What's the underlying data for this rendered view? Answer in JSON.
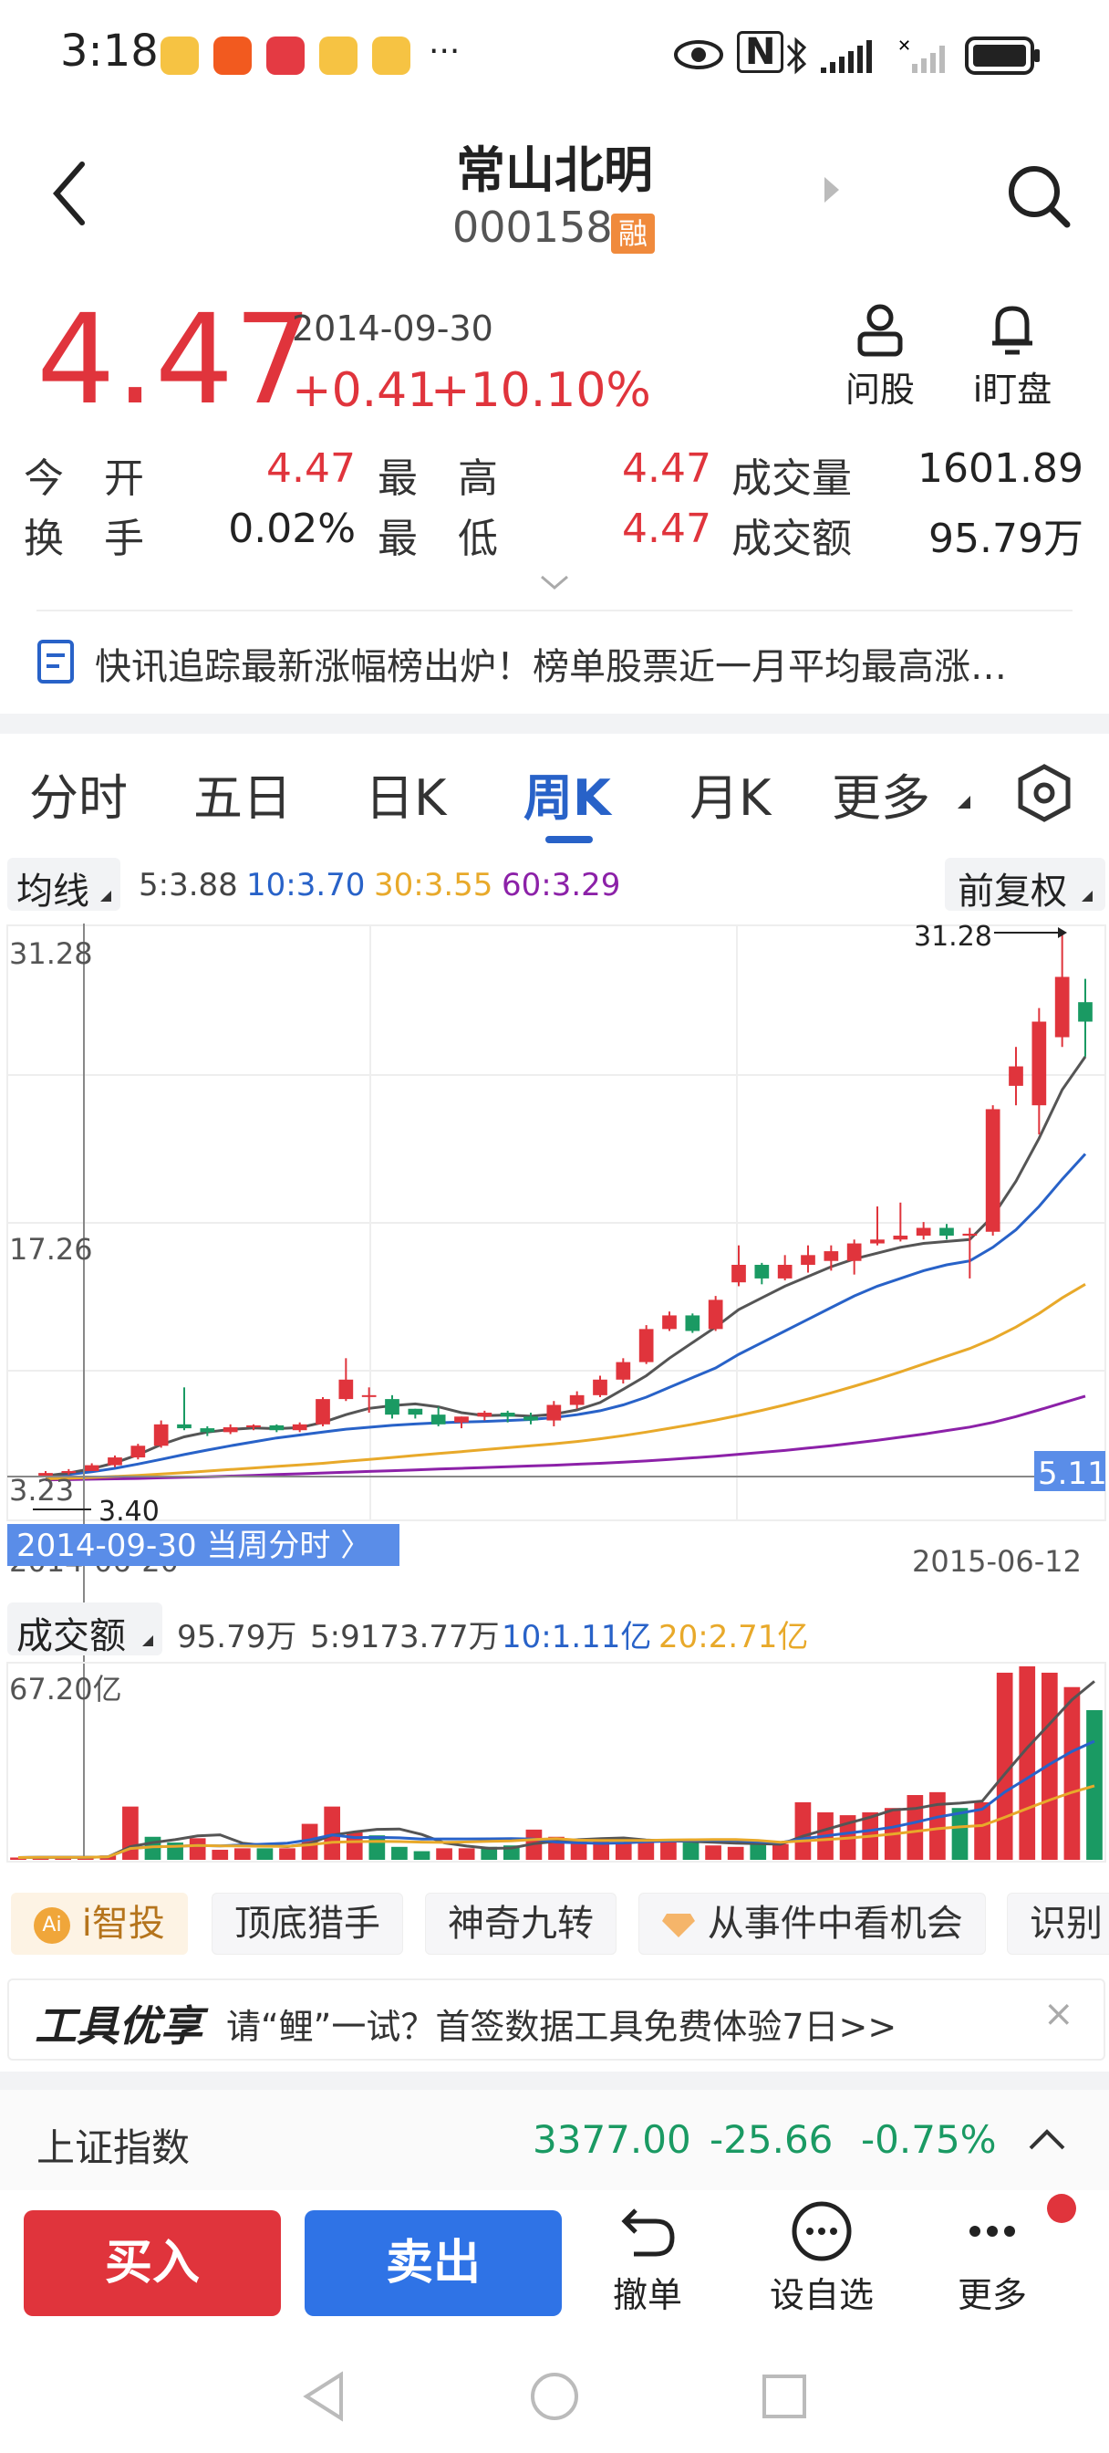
{
  "status": {
    "time": "3:18",
    "more": "···",
    "nfc": "N"
  },
  "stock": {
    "name": "常山北明",
    "code": "000158",
    "margin_badge": "融",
    "price": "4.47",
    "date": "2014-09-30",
    "change": "+0.41",
    "change_pct": "+10.10%",
    "ask_label": "问股",
    "watch_label": "i盯盘"
  },
  "quote": {
    "open_label": "今　开",
    "open_value": "4.47",
    "high_label": "最　高",
    "high_value": "4.47",
    "volume_label": "成交量",
    "volume_value": "1601.89",
    "turnover_label": "换　手",
    "turnover_value": "0.02%",
    "low_label": "最　低",
    "low_value": "4.47",
    "amount_label": "成交额",
    "amount_value": "95.79万"
  },
  "news": {
    "text": "快讯追踪最新涨幅榜出炉！榜单股票近一月平均最高涨…"
  },
  "tabs": [
    "分时",
    "五日",
    "日K",
    "周K",
    "月K",
    "更多"
  ],
  "active_tab": "周K",
  "ma_bar": {
    "selector": "均线",
    "ma5": "5:3.88",
    "ma10": "10:3.70",
    "ma30": "30:3.55",
    "ma60": "60:3.29",
    "adjust": "前复权"
  },
  "kline": {
    "axis_top": "31.28",
    "axis_mid": "17.26",
    "axis_bottom": "3.23",
    "max_label": "31.28",
    "min_label": "3.40",
    "cursor_price": "5.11",
    "cursor_link": "2014-09-30 当周分时 〉",
    "start_date": "2014-06-20",
    "end_date": "2015-06-12"
  },
  "vol_bar": {
    "selector": "成交额",
    "value": "95.79万",
    "ma5": "5:9173.77万",
    "ma10": "10:1.11亿",
    "ma20": "20:2.71亿",
    "axis_top": "67.20亿"
  },
  "chips": [
    "i智投",
    "顶底猎手",
    "神奇九转",
    "从事件中看机会",
    "识别"
  ],
  "ai_badge": "Ai",
  "promo": {
    "brand": "工具优享",
    "text": "请“鲤”一试？首签数据工具免费体验7日>>",
    "close": "×"
  },
  "index": {
    "name": "上证指数",
    "value": "3377.00",
    "change": "-25.66",
    "pct": "-0.75%"
  },
  "bottom": {
    "buy": "买入",
    "sell": "卖出",
    "cancel": "撤单",
    "watch": "设自选",
    "more": "更多"
  },
  "colors": {
    "up": "#e0343c",
    "down": "#1a9a63",
    "accent": "#2862c8",
    "ma5": "#555555",
    "ma10": "#2862c8",
    "ma30": "#e8a92a",
    "ma60": "#8c21a8"
  },
  "chart_data": {
    "type": "candlestick",
    "x_range": [
      "2014-06-20",
      "2015-06-12"
    ],
    "ylim": [
      3.23,
      31.28
    ],
    "candles": [
      {
        "o": 3.4,
        "c": 3.6,
        "h": 3.7,
        "l": 3.4
      },
      {
        "o": 3.6,
        "c": 3.7,
        "h": 3.8,
        "l": 3.5
      },
      {
        "o": 3.7,
        "c": 4.0,
        "h": 4.1,
        "l": 3.7
      },
      {
        "o": 4.0,
        "c": 4.4,
        "h": 4.5,
        "l": 3.9
      },
      {
        "o": 4.4,
        "c": 5.0,
        "h": 5.1,
        "l": 4.3
      },
      {
        "o": 5.0,
        "c": 6.1,
        "h": 6.3,
        "l": 4.9
      },
      {
        "o": 6.1,
        "c": 5.9,
        "h": 8.0,
        "l": 5.8
      },
      {
        "o": 5.9,
        "c": 5.7,
        "h": 6.0,
        "l": 5.5
      },
      {
        "o": 5.7,
        "c": 5.95,
        "h": 6.1,
        "l": 5.6
      },
      {
        "o": 5.95,
        "c": 6.05,
        "h": 6.1,
        "l": 5.8
      },
      {
        "o": 6.05,
        "c": 5.8,
        "h": 6.1,
        "l": 5.7
      },
      {
        "o": 5.8,
        "c": 6.1,
        "h": 6.2,
        "l": 5.7
      },
      {
        "o": 6.1,
        "c": 7.4,
        "h": 7.5,
        "l": 6.0
      },
      {
        "o": 7.4,
        "c": 8.4,
        "h": 9.5,
        "l": 7.3
      },
      {
        "o": 7.6,
        "c": 7.6,
        "h": 8.0,
        "l": 6.7
      },
      {
        "o": 7.4,
        "c": 6.6,
        "h": 7.6,
        "l": 6.4
      },
      {
        "o": 6.9,
        "c": 6.6,
        "h": 6.9,
        "l": 6.4
      },
      {
        "o": 6.6,
        "c": 6.1,
        "h": 7.0,
        "l": 6.0
      },
      {
        "o": 6.2,
        "c": 6.5,
        "h": 6.5,
        "l": 5.9
      },
      {
        "o": 6.5,
        "c": 6.7,
        "h": 6.8,
        "l": 6.3
      },
      {
        "o": 6.7,
        "c": 6.5,
        "h": 6.8,
        "l": 6.2
      },
      {
        "o": 6.5,
        "c": 6.3,
        "h": 6.7,
        "l": 6.1
      },
      {
        "o": 6.3,
        "c": 7.1,
        "h": 7.3,
        "l": 6.0
      },
      {
        "o": 7.1,
        "c": 7.6,
        "h": 7.8,
        "l": 6.9
      },
      {
        "o": 7.6,
        "c": 8.4,
        "h": 8.6,
        "l": 7.5
      },
      {
        "o": 8.4,
        "c": 9.3,
        "h": 9.5,
        "l": 8.2
      },
      {
        "o": 9.3,
        "c": 11.0,
        "h": 11.2,
        "l": 9.2
      },
      {
        "o": 11.0,
        "c": 11.7,
        "h": 11.9,
        "l": 10.9
      },
      {
        "o": 11.7,
        "c": 10.9,
        "h": 11.8,
        "l": 10.8
      },
      {
        "o": 11.0,
        "c": 12.5,
        "h": 12.7,
        "l": 10.9
      },
      {
        "o": 13.4,
        "c": 14.3,
        "h": 15.3,
        "l": 13.2
      },
      {
        "o": 14.3,
        "c": 13.6,
        "h": 14.4,
        "l": 13.3
      },
      {
        "o": 13.6,
        "c": 14.3,
        "h": 14.8,
        "l": 13.5
      },
      {
        "o": 14.3,
        "c": 14.8,
        "h": 15.3,
        "l": 13.9
      },
      {
        "o": 14.5,
        "c": 15.0,
        "h": 15.3,
        "l": 14.0
      },
      {
        "o": 14.5,
        "c": 15.4,
        "h": 15.6,
        "l": 13.8
      },
      {
        "o": 15.4,
        "c": 15.6,
        "h": 17.3,
        "l": 15.3
      },
      {
        "o": 15.6,
        "c": 15.8,
        "h": 17.5,
        "l": 15.5
      },
      {
        "o": 15.8,
        "c": 16.2,
        "h": 16.5,
        "l": 15.6
      },
      {
        "o": 16.2,
        "c": 15.8,
        "h": 16.4,
        "l": 15.6
      },
      {
        "o": 15.8,
        "c": 15.9,
        "h": 16.2,
        "l": 13.6
      },
      {
        "o": 16.0,
        "c": 22.3,
        "h": 22.5,
        "l": 15.8
      },
      {
        "o": 23.5,
        "c": 24.5,
        "h": 25.5,
        "l": 22.5
      },
      {
        "o": 22.5,
        "c": 26.8,
        "h": 27.5,
        "l": 21.0
      },
      {
        "o": 26.0,
        "c": 29.1,
        "h": 31.28,
        "l": 25.5
      },
      {
        "o": 27.8,
        "c": 26.8,
        "h": 29.0,
        "l": 25.0
      }
    ],
    "ma5": [
      3.45,
      3.6,
      3.82,
      4.12,
      4.54,
      5.06,
      5.46,
      5.7,
      5.84,
      5.92,
      5.88,
      5.93,
      6.2,
      6.6,
      6.92,
      7.06,
      7.15,
      7.0,
      6.7,
      6.55,
      6.58,
      6.52,
      6.62,
      6.84,
      7.22,
      7.9,
      8.6,
      9.5,
      10.3,
      11.1,
      12.0,
      12.6,
      13.2,
      13.7,
      14.2,
      14.6,
      14.9,
      15.2,
      15.4,
      15.5,
      15.6,
      16.8,
      18.6,
      20.8,
      23.3,
      25.0
    ],
    "ma10": [
      3.42,
      3.52,
      3.66,
      3.84,
      4.06,
      4.3,
      4.55,
      4.78,
      5.0,
      5.2,
      5.4,
      5.55,
      5.7,
      5.85,
      5.95,
      6.05,
      6.12,
      6.18,
      6.22,
      6.25,
      6.3,
      6.35,
      6.45,
      6.6,
      6.8,
      7.1,
      7.5,
      8.0,
      8.5,
      9.0,
      9.7,
      10.3,
      10.9,
      11.5,
      12.1,
      12.7,
      13.2,
      13.6,
      14.0,
      14.3,
      14.5,
      15.2,
      16.1,
      17.3,
      18.7,
      20.0
    ],
    "ma30": [
      3.3,
      3.33,
      3.37,
      3.42,
      3.48,
      3.55,
      3.62,
      3.7,
      3.78,
      3.86,
      3.94,
      4.02,
      4.1,
      4.2,
      4.3,
      4.4,
      4.5,
      4.6,
      4.7,
      4.8,
      4.9,
      5.0,
      5.1,
      5.22,
      5.36,
      5.52,
      5.7,
      5.9,
      6.1,
      6.32,
      6.56,
      6.82,
      7.1,
      7.4,
      7.72,
      8.06,
      8.42,
      8.8,
      9.2,
      9.6,
      10.0,
      10.5,
      11.1,
      11.8,
      12.6,
      13.3
    ],
    "ma60": [
      3.25,
      3.26,
      3.28,
      3.3,
      3.32,
      3.35,
      3.38,
      3.41,
      3.44,
      3.48,
      3.52,
      3.56,
      3.6,
      3.64,
      3.68,
      3.72,
      3.76,
      3.8,
      3.84,
      3.88,
      3.92,
      3.96,
      4.0,
      4.05,
      4.1,
      4.16,
      4.22,
      4.3,
      4.38,
      4.46,
      4.56,
      4.66,
      4.76,
      4.88,
      5.0,
      5.14,
      5.28,
      5.44,
      5.6,
      5.78,
      5.96,
      6.2,
      6.5,
      6.84,
      7.2,
      7.55
    ],
    "volume_ylim": [
      0,
      67.2
    ],
    "volume": [
      0.8,
      0.9,
      0.9,
      1.0,
      1.5,
      18.5,
      8.0,
      6.0,
      7.5,
      3.5,
      4.0,
      4.0,
      4.0,
      12.5,
      18.5,
      9.5,
      8.5,
      4.5,
      3.0,
      4.0,
      4.0,
      4.5,
      5.0,
      10.5,
      8.0,
      7.0,
      6.5,
      6.0,
      7.0,
      6.5,
      6.0,
      5.0,
      4.5,
      6.0,
      5.5,
      20.0,
      16.5,
      15.5,
      16.5,
      18.0,
      22.5,
      23.5,
      18.0,
      20.0,
      65.0,
      68.0,
      65.0,
      60.0,
      52.0
    ]
  }
}
